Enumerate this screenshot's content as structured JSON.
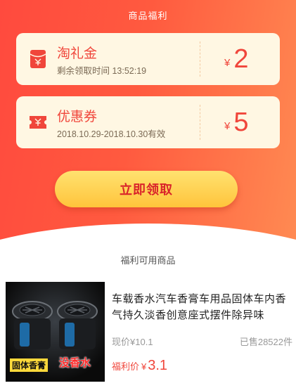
{
  "header": {
    "title": "商品福利"
  },
  "coupons": [
    {
      "name": "淘礼金",
      "sub": "剩余领取时间 13:52:19",
      "currency": "¥",
      "amount": "2",
      "icon": "red-envelope-icon"
    },
    {
      "name": "优惠券",
      "sub": "2018.10.29-2018.10.30有效",
      "currency": "¥",
      "amount": "5",
      "icon": "ticket-icon"
    }
  ],
  "cta": {
    "label": "立即领取"
  },
  "section": {
    "title": "福利可用商品"
  },
  "product": {
    "title": "车载香水汽车香膏车用品固体车内香气持久淡香创意座式摆件除异味",
    "image_labels": [
      "固体香膏",
      "没香水"
    ],
    "original_price_label": "现价",
    "original_price_currency": "¥",
    "original_price": "10.1",
    "sold": "已售28522件",
    "deal_price_label": "福利价",
    "deal_price_currency": "¥",
    "deal_price": "3.1"
  },
  "colors": {
    "accent": "#f0463b",
    "hero_start": "#ff4a3e",
    "hero_end": "#ff8a52",
    "coupon_bg": "#fff7e3",
    "cta": "#ffc43b"
  }
}
